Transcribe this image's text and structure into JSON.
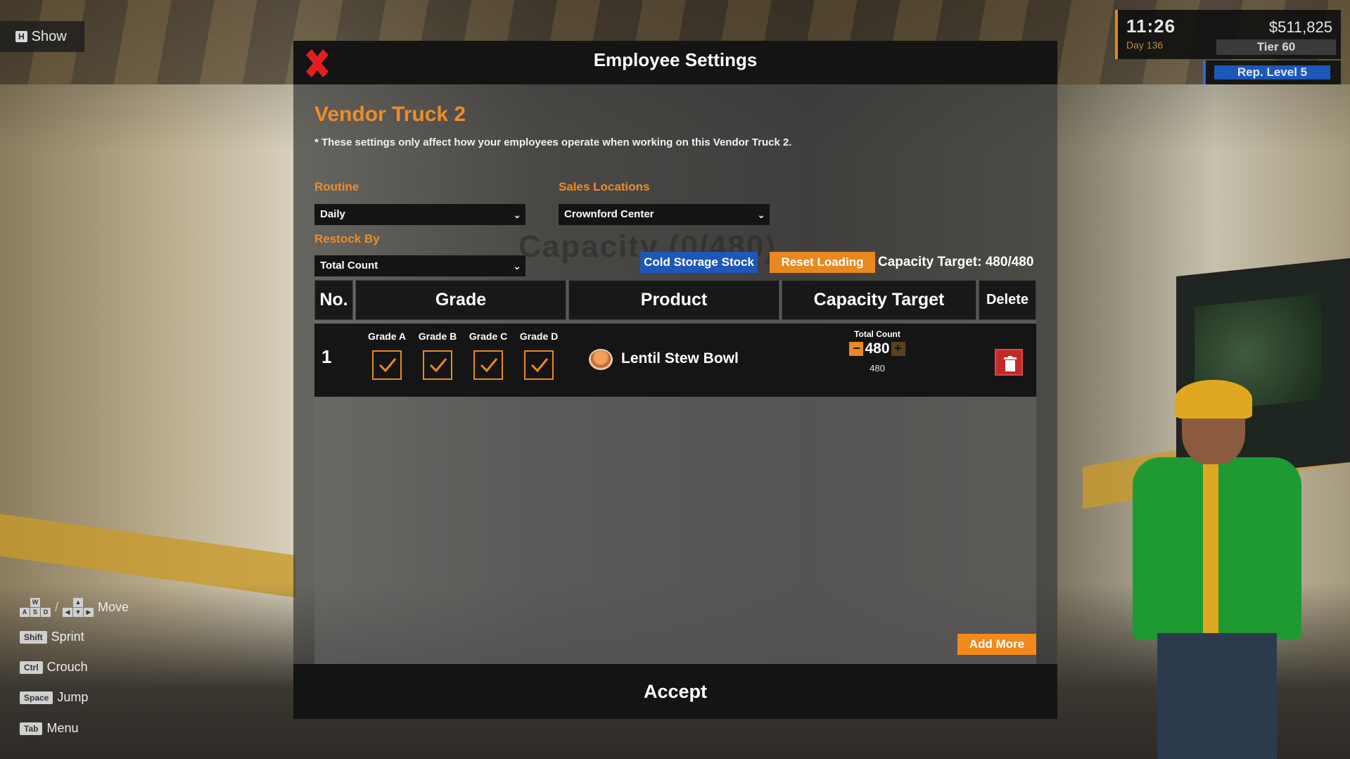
{
  "hud": {
    "time": "11:26",
    "day": "Day 136",
    "money": "$511,825",
    "tier": "Tier 60",
    "reputation": "Rep. Level 5"
  },
  "hint": {
    "key": "H",
    "label": "Show"
  },
  "controls": {
    "move": {
      "keys": [
        "W",
        "A",
        "S",
        "D"
      ],
      "label": "Move"
    },
    "sprint": {
      "key": "Shift",
      "label": "Sprint"
    },
    "crouch": {
      "key": "Ctrl",
      "label": "Crouch"
    },
    "jump": {
      "key": "Space",
      "label": "Jump"
    },
    "menu": {
      "key": "Tab",
      "label": "Menu"
    }
  },
  "dialog": {
    "title": "Employee Settings",
    "truck_name": "Vendor Truck 2",
    "note": "* These settings only affect how your employees operate when working on this Vendor Truck 2.",
    "routine": {
      "label": "Routine",
      "value": "Daily"
    },
    "sales_locations": {
      "label": "Sales Locations",
      "value": "Crownford Center"
    },
    "restock_by": {
      "label": "Restock By",
      "value": "Total Count"
    },
    "capacity_ghost": "Capacity (0/480)",
    "cold_storage_button": "Cold Storage Stock",
    "reset_loading_button": "Reset Loading",
    "capacity_target_summary": "Capacity Target: 480/480",
    "table": {
      "headers": {
        "no": "No.",
        "grade": "Grade",
        "product": "Product",
        "capacity": "Capacity Target",
        "delete": "Delete"
      },
      "rows": [
        {
          "no": "1",
          "grades": [
            {
              "label": "Grade A",
              "checked": true
            },
            {
              "label": "Grade B",
              "checked": true
            },
            {
              "label": "Grade C",
              "checked": true
            },
            {
              "label": "Grade D",
              "checked": true
            }
          ],
          "product": "Lentil Stew Bowl",
          "count_label": "Total Count",
          "count_value": "480",
          "count_sub": "480"
        }
      ]
    },
    "add_more_button": "Add More",
    "accept_button": "Accept"
  },
  "colors": {
    "accent": "#ee8c2a",
    "blue": "#1d58b8",
    "delete": "#c62828"
  }
}
